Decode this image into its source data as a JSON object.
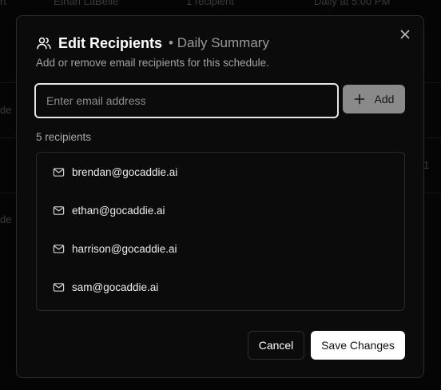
{
  "background_table": {
    "row1": {
      "col1": "rt",
      "col2": "Ethan LaBelle",
      "col3": "1 recipient",
      "col4": "Daily at 5:00 PM"
    },
    "left_fragment_1": "de",
    "right_fragment": "1",
    "left_fragment_2": "de"
  },
  "dialog": {
    "title": "Edit Recipients",
    "subtitle": "• Daily Summary",
    "description": "Add or remove email recipients for this schedule.",
    "title_icon": "users-icon",
    "close_icon": "close-icon"
  },
  "input": {
    "placeholder": "Enter email address",
    "value": ""
  },
  "add_button": {
    "label": "Add",
    "icon": "plus-icon"
  },
  "recipients": {
    "count_label": "5 recipients",
    "items": [
      {
        "email": "brendan@gocaddie.ai",
        "icon": "mail-icon"
      },
      {
        "email": "ethan@gocaddie.ai",
        "icon": "mail-icon"
      },
      {
        "email": "harrison@gocaddie.ai",
        "icon": "mail-icon"
      },
      {
        "email": "sam@gocaddie.ai",
        "icon": "mail-icon"
      }
    ]
  },
  "footer": {
    "cancel_label": "Cancel",
    "save_label": "Save Changes"
  },
  "colors": {
    "background": "#050505",
    "modal": "#0b0b0b",
    "border": "#2b2b2b",
    "primary_button": "#ffffff",
    "add_button": "#8a8a8a",
    "muted_text": "#a3a3a3"
  }
}
